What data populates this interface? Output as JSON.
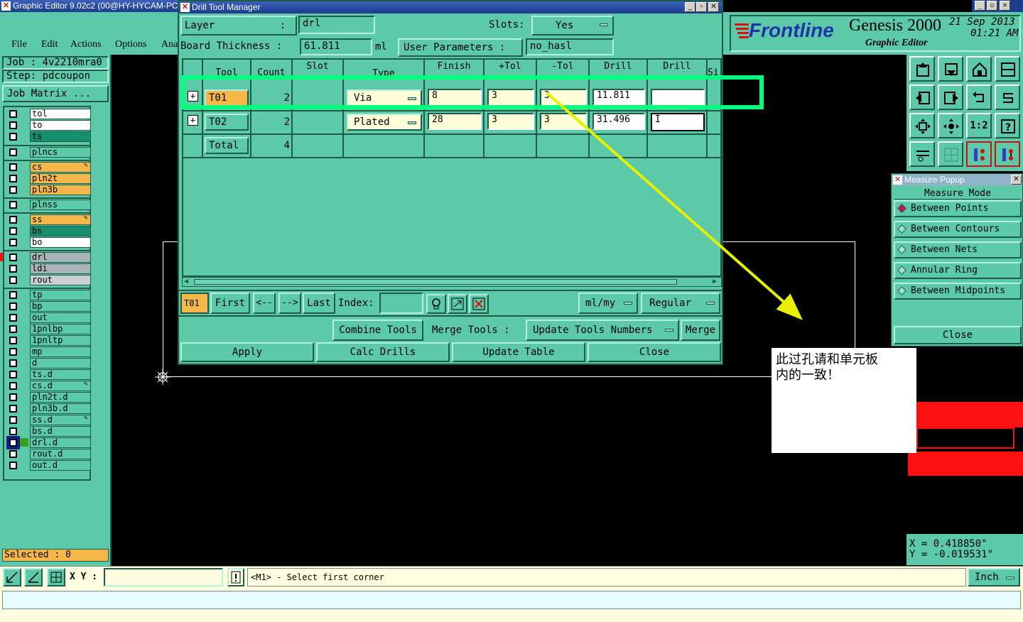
{
  "main_window": {
    "title": "Graphic Editor 9.02c2 (00@HY-HYCAM-PC",
    "menu": [
      "File",
      "Edit",
      "Actions",
      "Options",
      "Ana"
    ]
  },
  "left_panel": {
    "job": "Job : 4v2210mra0",
    "step": "Step: pdcoupon",
    "job_matrix": "Job Matrix ...",
    "selected": "Selected : 0",
    "layers": [
      {
        "name": "tol",
        "color": "#ffffff"
      },
      {
        "name": "to",
        "color": "#ffffff"
      },
      {
        "name": "ts",
        "color": "#168f6e"
      },
      {
        "name": "plncs",
        "color": "#5ccaa9"
      },
      {
        "name": "cs",
        "color": "#f5b64a"
      },
      {
        "name": "pln2t",
        "color": "#f5b64a"
      },
      {
        "name": "pln3b",
        "color": "#f5b64a"
      },
      {
        "name": "plnss",
        "color": "#5ccaa9"
      },
      {
        "name": "ss",
        "color": "#f5b64a"
      },
      {
        "name": "bs",
        "color": "#168f6e"
      },
      {
        "name": "bo",
        "color": "#ffffff"
      },
      {
        "name": "drl",
        "color": "#a8b4b8"
      },
      {
        "name": "ldi",
        "color": "#a8b4b8"
      },
      {
        "name": "rout",
        "color": "#c8d0d0"
      },
      {
        "name": "tp",
        "color": "#5ccaa9"
      },
      {
        "name": "bp",
        "color": "#5ccaa9"
      },
      {
        "name": "out",
        "color": "#5ccaa9"
      },
      {
        "name": "1pnlbp",
        "color": "#5ccaa9"
      },
      {
        "name": "1pnltp",
        "color": "#5ccaa9"
      },
      {
        "name": "mp",
        "color": "#5ccaa9"
      },
      {
        "name": "d",
        "color": "#5ccaa9"
      },
      {
        "name": "ts.d",
        "color": "#5ccaa9"
      },
      {
        "name": "cs.d",
        "color": "#5ccaa9"
      },
      {
        "name": "pln2t.d",
        "color": "#5ccaa9"
      },
      {
        "name": "pln3b.d",
        "color": "#5ccaa9"
      },
      {
        "name": "ss.d",
        "color": "#5ccaa9"
      },
      {
        "name": "bs.d",
        "color": "#5ccaa9"
      },
      {
        "name": "drl.d",
        "color": "#5ccaa9"
      },
      {
        "name": "rout.d",
        "color": "#5ccaa9"
      },
      {
        "name": "out.d",
        "color": "#5ccaa9"
      }
    ]
  },
  "drill_dialog": {
    "title": "Drill Tool Manager",
    "layer_label": "Layer",
    "layer_colon": ":",
    "layer_value": "drl",
    "slots_label": "Slots:",
    "slots_value": "Yes",
    "board_thickness_label": "Board Thickness :",
    "board_thickness_value": "61.811",
    "board_thickness_unit": "ml",
    "user_params_label": "User Parameters :",
    "user_params_value": "no_hasl",
    "columns": [
      "Tool",
      "Count",
      "Slot",
      "Type",
      "Finish",
      "+Tol",
      "-Tol",
      "Drill",
      "Drill",
      "Si"
    ],
    "rows": [
      {
        "tool": "T01",
        "count": "2",
        "type": "Via",
        "finish": "8",
        "ptol": "3",
        "mtol": "3",
        "drill": "11.811",
        "drill2": ""
      },
      {
        "tool": "T02",
        "count": "2",
        "type": "Plated",
        "finish": "28",
        "ptol": "3",
        "mtol": "3",
        "drill": "31.496",
        "drill2": "I"
      }
    ],
    "total_label": "Total",
    "total_count": "4",
    "nav_current": "T01",
    "first": "First",
    "prev": "<--",
    "next": "-->",
    "last": "Last",
    "index_label": "Index:",
    "units": "ml/my",
    "mode": "Regular",
    "combine": "Combine Tools",
    "merge_label": "Merge Tools :",
    "update_numbers": "Update Tools Numbers",
    "merge": "Merge",
    "apply": "Apply",
    "calc": "Calc Drills",
    "update_table": "Update Table",
    "close": "Close"
  },
  "brand": {
    "logo": "Frontline",
    "product": "Genesis 2000",
    "subtitle": "Graphic Editor",
    "date": "21 Sep 2013",
    "time": "01:21 AM"
  },
  "measure": {
    "title": "Measure Popup",
    "mode_label": "Measure Mode",
    "modes": [
      "Between Points",
      "Between Contours",
      "Between Nets",
      "Annular Ring",
      "Between Midpoints"
    ],
    "selected_mode": "Between Points",
    "close": "Close"
  },
  "coords": {
    "x": "X = 0.418850\"",
    "y": "Y = -0.019531\""
  },
  "annotation": {
    "line1": "此过孔请和单元板",
    "line2": "内的一致！"
  },
  "status": {
    "xy_label": "X Y :",
    "prompt": "<M1> - Select first corner",
    "units": "Inch",
    "one_to_two": "1:2"
  },
  "colors": {
    "teal": "#5ccaa9",
    "highlight": "#00ff7f",
    "arrow": "#e8f000",
    "orange": "#f5b64a"
  }
}
